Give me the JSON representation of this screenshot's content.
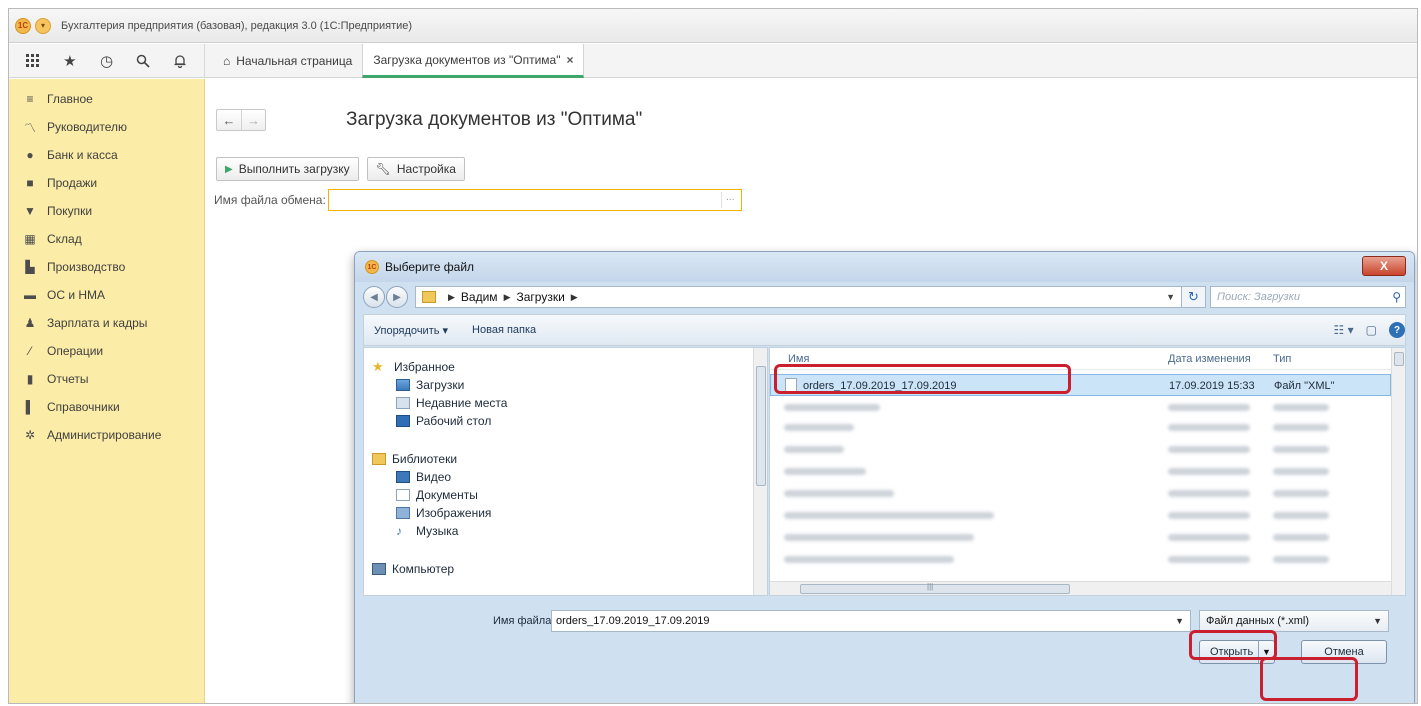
{
  "window": {
    "title": "Бухгалтерия предприятия (базовая), редакция 3.0 (1С:Предприятие)",
    "logo_text": "1С"
  },
  "tabs": [
    {
      "label": "Начальная страница"
    },
    {
      "label": "Загрузка документов из \"Оптима\""
    }
  ],
  "sidebar": {
    "items": [
      {
        "label": "Главное",
        "icon": "menu-icon"
      },
      {
        "label": "Руководителю",
        "icon": "trend-icon"
      },
      {
        "label": "Банк и касса",
        "icon": "coin-icon"
      },
      {
        "label": "Продажи",
        "icon": "bag-icon"
      },
      {
        "label": "Покупки",
        "icon": "cart-icon"
      },
      {
        "label": "Склад",
        "icon": "warehouse-icon"
      },
      {
        "label": "Производство",
        "icon": "factory-icon"
      },
      {
        "label": "ОС и НМА",
        "icon": "truck-icon"
      },
      {
        "label": "Зарплата и кадры",
        "icon": "person-icon"
      },
      {
        "label": "Операции",
        "icon": "debit-credit-icon"
      },
      {
        "label": "Отчеты",
        "icon": "bar-chart-icon"
      },
      {
        "label": "Справочники",
        "icon": "book-icon"
      },
      {
        "label": "Администрирование",
        "icon": "gear-icon"
      }
    ]
  },
  "form": {
    "title": "Загрузка документов из \"Оптима\"",
    "run_button": "Выполнить загрузку",
    "settings_button": "Настройка",
    "file_label": "Имя файла обмена:",
    "file_value": "",
    "file_select_text": "..."
  },
  "dialog": {
    "title": "Выберите файл",
    "close_label": "X",
    "path": [
      "Вадим",
      "Загрузки"
    ],
    "search_placeholder": "Поиск: Загрузки",
    "organize": "Упорядочить ▾",
    "new_folder": "Новая папка",
    "nav": {
      "favorites": "Избранное",
      "favorites_items": [
        "Загрузки",
        "Недавние места",
        "Рабочий стол"
      ],
      "libraries": "Библиотеки",
      "libraries_items": [
        "Видео",
        "Документы",
        "Изображения",
        "Музыка"
      ],
      "computer": "Компьютер"
    },
    "columns": {
      "name": "Имя",
      "modified": "Дата изменения",
      "type": "Тип"
    },
    "selected_file": {
      "name": "orders_17.09.2019_17.09.2019",
      "modified": "17.09.2019 15:33",
      "type": "Файл \"XML\""
    },
    "scroll_mark": "|||",
    "file_name_label": "Имя файла:",
    "file_name_value": "orders_17.09.2019_17.09.2019",
    "file_type": "Файл данных (*.xml)",
    "open_button": "Открыть",
    "cancel_button": "Отмена"
  },
  "colors": {
    "sidebar_bg": "#fbeca7",
    "active_tab_accent": "#3da66a",
    "input_focus": "#f0b400",
    "highlight": "#c91f2e",
    "dialog_frame": "#cfe0f1"
  }
}
